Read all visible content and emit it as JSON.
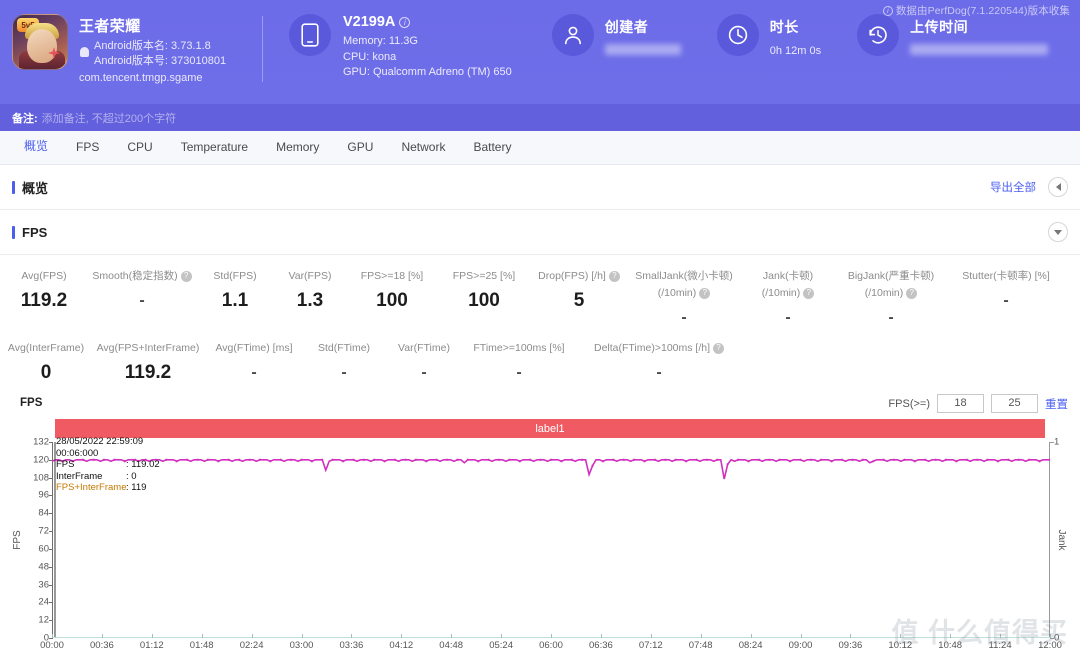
{
  "header": {
    "version_note": "数据由PerfDog(7.1.220544)版本收集",
    "info_icon": "info-icon",
    "app": {
      "name": "王者荣耀",
      "version_name": "Android版本名: 3.73.1.8",
      "version_code": "Android版本号: 373010801",
      "package": "com.tencent.tmgp.sgame"
    },
    "device": {
      "model": "V2199A",
      "memory": "Memory: 11.3G",
      "cpu": "CPU: kona",
      "gpu": "GPU: Qualcomm Adreno (TM) 650"
    },
    "creator": {
      "title": "创建者",
      "value": ""
    },
    "duration": {
      "title": "时长",
      "value": "0h 12m 0s"
    },
    "upload_time": {
      "title": "上传时间",
      "value": ""
    },
    "remark": {
      "label": "备注:",
      "placeholder": "添加备注, 不超过200个字符"
    }
  },
  "tabs": [
    {
      "label": "概览",
      "active": true
    },
    {
      "label": "FPS",
      "active": false
    },
    {
      "label": "CPU",
      "active": false
    },
    {
      "label": "Temperature",
      "active": false
    },
    {
      "label": "Memory",
      "active": false
    },
    {
      "label": "GPU",
      "active": false
    },
    {
      "label": "Network",
      "active": false
    },
    {
      "label": "Battery",
      "active": false
    }
  ],
  "overview_section": {
    "title": "概览",
    "export_all": "导出全部"
  },
  "fps_section": {
    "title": "FPS"
  },
  "metrics": {
    "row1": [
      {
        "label": "Avg(FPS)",
        "sub": "",
        "help": false,
        "value": "119.2"
      },
      {
        "label": "Smooth(稳定指数)",
        "sub": "",
        "help": true,
        "value": "-"
      },
      {
        "label": "Std(FPS)",
        "sub": "",
        "help": false,
        "value": "1.1"
      },
      {
        "label": "Var(FPS)",
        "sub": "",
        "help": false,
        "value": "1.3"
      },
      {
        "label": "FPS>=18 [%]",
        "sub": "",
        "help": false,
        "value": "100"
      },
      {
        "label": "FPS>=25 [%]",
        "sub": "",
        "help": false,
        "value": "100"
      },
      {
        "label": "Drop(FPS) [/h]",
        "sub": "",
        "help": true,
        "value": "5"
      },
      {
        "label": "SmallJank(微小卡顿)",
        "sub": "(/10min)",
        "help": true,
        "value": "-"
      },
      {
        "label": "Jank(卡顿)",
        "sub": "(/10min)",
        "help": true,
        "value": "-"
      },
      {
        "label": "BigJank(严重卡顿)",
        "sub": "(/10min)",
        "help": true,
        "value": "-"
      },
      {
        "label": "Stutter(卡顿率) [%]",
        "sub": "",
        "help": false,
        "value": "-"
      }
    ],
    "row2": [
      {
        "label": "Avg(InterFrame)",
        "sub": "",
        "help": false,
        "value": "0"
      },
      {
        "label": "Avg(FPS+InterFrame)",
        "sub": "",
        "help": false,
        "value": "119.2"
      },
      {
        "label": "Avg(FTime) [ms]",
        "sub": "",
        "help": false,
        "value": "-"
      },
      {
        "label": "Std(FTime)",
        "sub": "",
        "help": false,
        "value": "-"
      },
      {
        "label": "Var(FTime)",
        "sub": "",
        "help": false,
        "value": "-"
      },
      {
        "label": "FTime>=100ms [%]",
        "sub": "",
        "help": false,
        "value": "-"
      },
      {
        "label": "Delta(FTime)>100ms [/h]",
        "sub": "",
        "help": true,
        "value": "-"
      }
    ]
  },
  "chart_controls": {
    "fps_label": "FPS(>=)",
    "threshold1": "18",
    "threshold2": "25",
    "reset": "重置"
  },
  "watermark": "值 什么值得买",
  "chart_data": {
    "type": "line",
    "title": "FPS",
    "band_label": "label1",
    "xlabel": "",
    "ylabel": "FPS",
    "y2label": "Jank",
    "ylim": [
      0,
      132
    ],
    "y2lim": [
      0,
      1
    ],
    "yticks": [
      0,
      12,
      24,
      36,
      48,
      60,
      72,
      84,
      96,
      108,
      120,
      132
    ],
    "y2ticks": [
      0,
      1
    ],
    "grid": false,
    "legend": "none",
    "xticks": [
      "00:00",
      "00:36",
      "01:12",
      "01:48",
      "02:24",
      "03:00",
      "03:36",
      "04:12",
      "04:48",
      "05:24",
      "06:00",
      "06:36",
      "07:12",
      "07:48",
      "08:24",
      "09:00",
      "09:36",
      "10:12",
      "10:48",
      "11:24",
      "12:00"
    ],
    "series": [
      {
        "name": "FPS",
        "color": "#d12fc0",
        "values": [
          119,
          120,
          120,
          119,
          120,
          120,
          119,
          120,
          120,
          120,
          119,
          120,
          120,
          120,
          119,
          120,
          120,
          119,
          120,
          120,
          120,
          119,
          120,
          120,
          120,
          119,
          120,
          120,
          119,
          120,
          120,
          120,
          119,
          120,
          120,
          120,
          119,
          120,
          120,
          120,
          119,
          120,
          120,
          120,
          119,
          120,
          120,
          120,
          119,
          120,
          120,
          120,
          119,
          120,
          120,
          119,
          120,
          120,
          120,
          119,
          120,
          120,
          120,
          119,
          120,
          120,
          120,
          119,
          120,
          120,
          120,
          119,
          120,
          120,
          120,
          119,
          120,
          120,
          120,
          113,
          119,
          120,
          120,
          120,
          119,
          120,
          120,
          120,
          119,
          120,
          120,
          120,
          119,
          120,
          120,
          120,
          119,
          120,
          120,
          120,
          119,
          120,
          120,
          120,
          119,
          120,
          120,
          120,
          119,
          120,
          120,
          120,
          119,
          120,
          120,
          120,
          119,
          120,
          120,
          118,
          120,
          120,
          120,
          119,
          120,
          120,
          120,
          119,
          120,
          120,
          120,
          119,
          120,
          120,
          120,
          119,
          120,
          120,
          120,
          119,
          120,
          120,
          120,
          119,
          120,
          120,
          120,
          119,
          120,
          120,
          120,
          119,
          120,
          120,
          120,
          110,
          116,
          120,
          120,
          119,
          120,
          120,
          120,
          119,
          120,
          120,
          120,
          119,
          120,
          120,
          120,
          119,
          120,
          120,
          120,
          119,
          120,
          120,
          120,
          119,
          120,
          120,
          120,
          119,
          120,
          120,
          120,
          119,
          120,
          120,
          120,
          119,
          120,
          120,
          107,
          117,
          120,
          119,
          120,
          120,
          120,
          119,
          120,
          120,
          120,
          119,
          120,
          120,
          120,
          119,
          120,
          120,
          120,
          119,
          120,
          120,
          120,
          119,
          120,
          120,
          120,
          119,
          120,
          120,
          120,
          119,
          120,
          120,
          120,
          119,
          120,
          120,
          120,
          119,
          120,
          120,
          118,
          119,
          120,
          120,
          120,
          119,
          120,
          120,
          120,
          119,
          120,
          120,
          120,
          119,
          120,
          120,
          120,
          119,
          120,
          120,
          120,
          119,
          120,
          120,
          120,
          119,
          120,
          120,
          120,
          119,
          120,
          120,
          120,
          119,
          120,
          120,
          120,
          119,
          120,
          120,
          120,
          119,
          120,
          120,
          120,
          119,
          120,
          120,
          120,
          119,
          120,
          120,
          120
        ]
      }
    ],
    "tooltip": {
      "datetime": "28/05/2022 22:59:09",
      "elapsed": "00:06:000",
      "rows": [
        {
          "key": "FPS",
          "value": ": 119.02"
        },
        {
          "key": "InterFrame",
          "value": ": 0"
        },
        {
          "key": "FPS+InterFrame",
          "value": ": 119"
        }
      ]
    }
  }
}
